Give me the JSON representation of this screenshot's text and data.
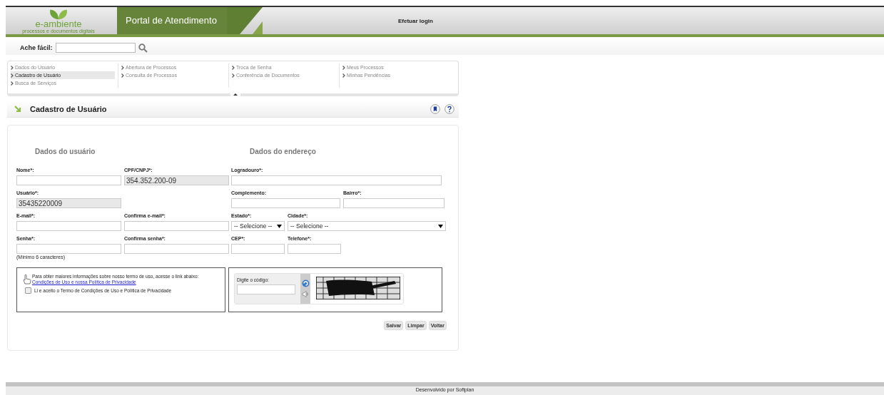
{
  "header": {
    "logo": "e-ambiente",
    "logo_tagline": "processos e documentos digitais",
    "portal_title": "Portal de Atendimento",
    "login": "Efetuar login"
  },
  "search": {
    "label": "Ache fácil:"
  },
  "menu": {
    "columns": [
      [
        {
          "label": "Dados do Usuário",
          "selected": false
        },
        {
          "label": "Cadastro de Usuário",
          "selected": true
        },
        {
          "label": "Busca de Serviços",
          "selected": false
        }
      ],
      [
        {
          "label": "Abertura de Processos",
          "selected": false
        },
        {
          "label": "Consulta de Processos",
          "selected": false
        }
      ],
      [
        {
          "label": "Troca de Senha",
          "selected": false
        },
        {
          "label": "Conferência de Documentos",
          "selected": false
        }
      ],
      [
        {
          "label": "Meus Processos",
          "selected": false
        },
        {
          "label": "Minhas Pendências",
          "selected": false
        }
      ]
    ]
  },
  "page_title": "Cadastro de Usuário",
  "form": {
    "left_heading": "Dados do usuário",
    "right_heading": "Dados do endereço",
    "left_rows": [
      [
        {
          "label": "Nome*:",
          "kind": "text",
          "disabled": false
        },
        {
          "label": "CPF/CNPJ*:",
          "kind": "text",
          "value": "354.352.200-09",
          "disabled": true
        }
      ],
      [
        {
          "label": "Usuário*:",
          "kind": "text",
          "value": "35435220009",
          "disabled": true
        }
      ],
      [
        {
          "label": "E-mail*:",
          "kind": "text",
          "disabled": false
        },
        {
          "label": "Confirma e-mail*:",
          "kind": "text",
          "disabled": false
        }
      ],
      [
        {
          "label": "Senha*:",
          "kind": "text",
          "disabled": false
        },
        {
          "label": "Confirma senha*:",
          "kind": "text",
          "disabled": false
        }
      ]
    ],
    "password_hint": "(Mínimo 6 caracteres)",
    "right_rows": [
      [
        {
          "label": "Logradouro*:",
          "kind": "text",
          "disabled": false
        }
      ],
      [
        {
          "label": "Complemento:",
          "kind": "text",
          "disabled": false
        },
        {
          "label": "Bairro*:",
          "kind": "text",
          "disabled": false
        }
      ],
      [
        {
          "label": "Estado*:",
          "kind": "select",
          "value": "-- Selecione --",
          "disabled": false
        },
        {
          "label": "Cidade*:",
          "kind": "select",
          "value": "-- Selecione --",
          "disabled": false
        }
      ],
      [
        {
          "label": "CEP*:",
          "kind": "text",
          "disabled": false
        },
        {
          "label": "Telefone*:",
          "kind": "text",
          "disabled": false
        }
      ]
    ],
    "terms_info": "Para obter maiores informações sobre nosso termo de uso, acesse o link abaixo:",
    "terms_link": "Condições de Uso e nossa Política de Privacidade",
    "accept_label": "Li e aceito o Termo de Condições de Uso e Política de Privacidade",
    "accept_checked": false,
    "captcha_label": "Digite o código:",
    "buttons": [
      "Salvar",
      "Limpar",
      "Voltar"
    ]
  },
  "footer": "Desenvolvido por Softplan"
}
